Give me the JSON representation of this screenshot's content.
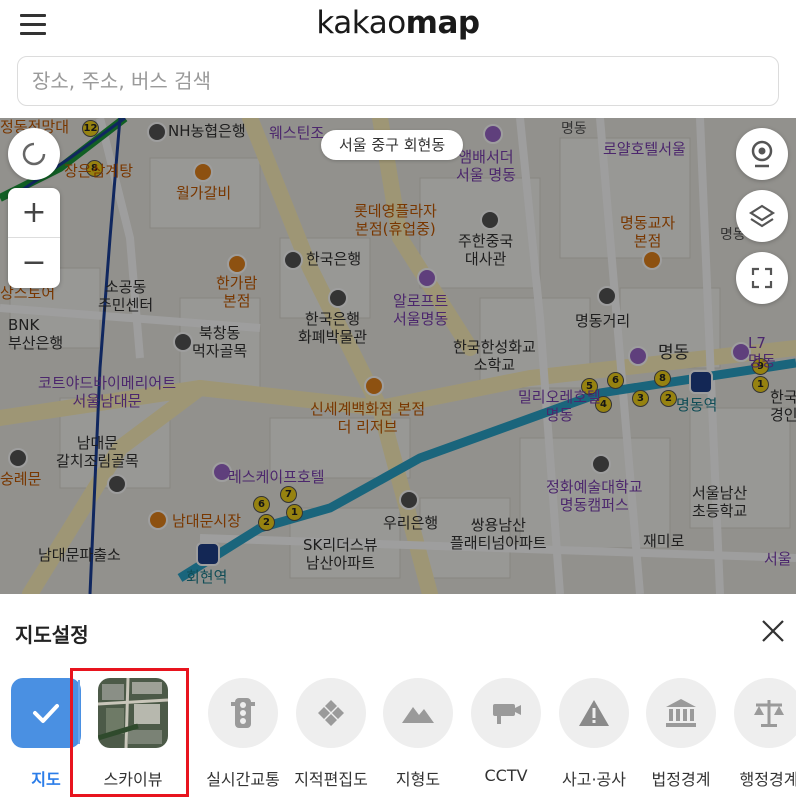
{
  "header": {
    "logo_light": "kakao",
    "logo_bold": "map",
    "search_placeholder": "장소, 주소, 버스 검색"
  },
  "map": {
    "location_chip": "서울 중구 회현동",
    "labels": {
      "l1": "NH농협은행",
      "l2": "웨스틴조",
      "l3": "앰배서더\n서울 명동",
      "l4": "명동",
      "l5": "로얄호텔서울",
      "l6": "장은삼계탕",
      "l7": "월가갈비",
      "l8": "롯데영플라자\n본점(휴업중)",
      "l9": "주한중국\n대사관",
      "l10": "명동교자\n본점",
      "l11": "명동",
      "l12": "한국은행",
      "l13": "소공동\n주민센터",
      "l14": "한가람\n본점",
      "l15": "알로프트\n서울명동",
      "l16": "상스토어",
      "l17": "BNK\n부산은행",
      "l18": "한국은행\n화폐박물관",
      "l19": "북창동\n먹자골목",
      "l20": "명동거리",
      "l21": "한국한성화교\n소학교",
      "l22": "명동",
      "l23": "L7\n명동",
      "l24": "코트야드바이메리어트\n서울남대문",
      "l25": "신세계백화점 본점\n더 리저브",
      "l26": "밀리오레호텔\n명동",
      "l27": "명동역",
      "l28": "한국\n경인",
      "l29": "남대문\n갈치조림골목",
      "l30": "숭례문",
      "l31": "레스케이프호텔",
      "l32": "정화예술대학교\n명동캠퍼스",
      "l33": "서울남산\n초등학교",
      "l34": "남대문시장",
      "l35": "우리은행",
      "l36": "쌍용남산\n플래티넘아파트",
      "l37": "재미로",
      "l38": "SK리더스뷰\n남산아파트",
      "l39": "남대문파출소",
      "l40": "회현역",
      "l41": "서울",
      "l42": "정동전망대"
    }
  },
  "panel": {
    "title": "지도설정",
    "options": [
      {
        "label": "지도",
        "icon": "check-icon",
        "selected": true
      },
      {
        "label": "스카이뷰",
        "icon": "satellite-thumbnail"
      },
      {
        "label": "실시간교통",
        "icon": "traffic-light-icon"
      },
      {
        "label": "지적편집도",
        "icon": "cadastral-icon"
      },
      {
        "label": "지형도",
        "icon": "mountain-icon"
      },
      {
        "label": "CCTV",
        "icon": "cctv-icon"
      },
      {
        "label": "사고·공사",
        "icon": "warning-icon"
      },
      {
        "label": "법정경계",
        "icon": "government-building-icon"
      },
      {
        "label": "행정경계",
        "icon": "scales-icon"
      }
    ]
  },
  "colors": {
    "accent_blue": "#2b7de9",
    "highlight_red": "#e8141e",
    "subway_line_blue": "#2aa3c9",
    "subway_line_green": "#1c9a3a"
  }
}
